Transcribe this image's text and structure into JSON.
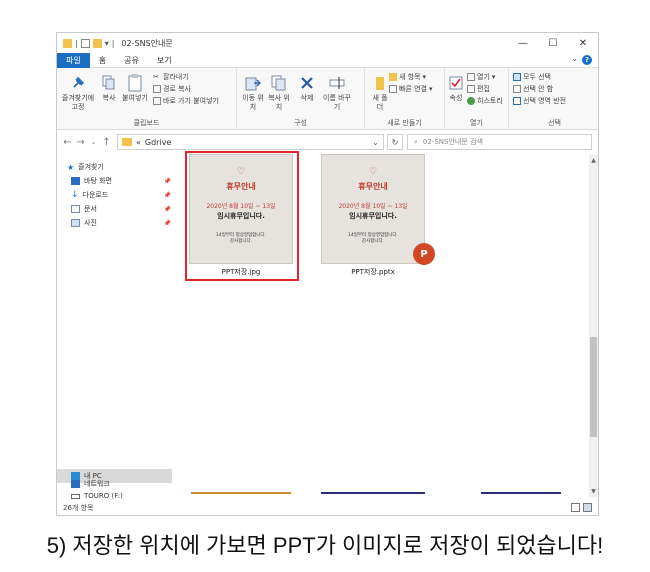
{
  "window": {
    "title": "02-SNS안내문",
    "controls": {
      "minimize": "—",
      "maximize": "☐",
      "close": "✕"
    }
  },
  "tabs": [
    "파일",
    "홈",
    "공유",
    "보기"
  ],
  "ribbon": {
    "clipboard": {
      "pin": "즐겨찾기에 고정",
      "copy": "복사",
      "paste": "붙여넣기",
      "cut": "잘라내기",
      "copy_path": "경로 복사",
      "paste_shortcut": "바로 가기 붙여넣기",
      "label": "클립보드"
    },
    "organize": {
      "move_to": "이동 위치",
      "copy_to": "복사 위치",
      "delete": "삭제",
      "rename": "이름 바꾸기",
      "label": "구성"
    },
    "new": {
      "new_folder": "새 폴더",
      "new_item": "새 항목",
      "easy_access": "빠른 연결",
      "label": "새로 만들기"
    },
    "open": {
      "properties": "속성",
      "open": "열기",
      "edit": "편집",
      "history": "히스토리",
      "label": "열기"
    },
    "select": {
      "select_all": "모두 선택",
      "select_none": "선택 안 함",
      "invert": "선택 영역 반전",
      "label": "선택"
    }
  },
  "address": {
    "path": "Gdrive",
    "search_placeholder": "02-SNS안내문 검색"
  },
  "nav": {
    "favorites": "즐겨찾기",
    "desktop": "바탕 화면",
    "downloads": "다운로드",
    "documents": "문서",
    "pictures": "사진",
    "this_pc": "내 PC",
    "drive": "TOURO (F:)",
    "network": "네트워크"
  },
  "files": [
    {
      "name": "PPT저장.jpg",
      "selected": true,
      "thumb": {
        "logo": "♡",
        "heading": "휴무안내",
        "date": "2020년 8월 10일 ~ 13일",
        "main": "임시휴무입니다.",
        "note_1": "14일부터 정상영업합니다.",
        "note_2": "감사합니다."
      }
    },
    {
      "name": "PPT저장.pptx",
      "selected": false,
      "badge": "P",
      "thumb": {
        "logo": "♡",
        "heading": "휴무안내",
        "date": "2020년 8월 10일 ~ 13일",
        "main": "임시휴무입니다.",
        "note_1": "14일부터 정상영업합니다.",
        "note_2": "감사합니다."
      }
    }
  ],
  "status": {
    "count": "26개 항목"
  },
  "caption": "5) 저장한 위치에 가보면 PPT가 이미지로 저장이 되었습니다!"
}
